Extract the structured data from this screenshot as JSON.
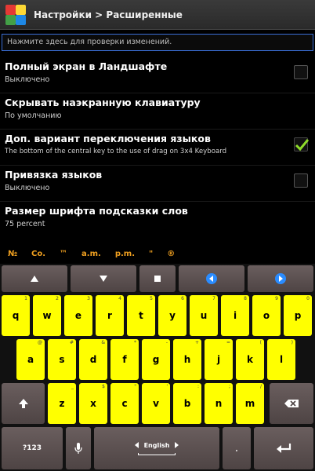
{
  "titlebar": {
    "title": "Настройки > Расширенные",
    "icon": "app-colorful-squares-icon"
  },
  "test_input": {
    "placeholder": "Нажмите здесь для проверки изменений."
  },
  "settings": [
    {
      "title": "Полный экран в Ландшафте",
      "summary": "Выключено",
      "checkbox": true,
      "checked": false
    },
    {
      "title": "Скрывать наэкранную клавиатуру",
      "summary": "По умолчанию",
      "checkbox": false
    },
    {
      "title": "Доп. вариант переключения языков",
      "summary": "The bottom of the central key to the use of drag on 3x4 Keyboard",
      "checkbox": true,
      "checked": true
    },
    {
      "title": "Привязка языков",
      "summary": "Выключено",
      "checkbox": true,
      "checked": false
    },
    {
      "title": "Размер шрифта подсказки слов",
      "summary": "75 percent",
      "checkbox": false
    }
  ],
  "suggestions": [
    "№",
    "Co.",
    "™",
    "a.m.",
    "p.m.",
    "\"",
    "®"
  ],
  "keyboard": {
    "nav_row": [
      "up-arrow-icon",
      "down-arrow-icon",
      "dot-icon",
      "left-circle-arrow-icon",
      "right-circle-arrow-icon"
    ],
    "row1": [
      {
        "l": "q",
        "h": "1"
      },
      {
        "l": "w",
        "h": "2"
      },
      {
        "l": "e",
        "h": "3"
      },
      {
        "l": "r",
        "h": "4"
      },
      {
        "l": "t",
        "h": "5"
      },
      {
        "l": "y",
        "h": "6"
      },
      {
        "l": "u",
        "h": "7"
      },
      {
        "l": "i",
        "h": "8"
      },
      {
        "l": "o",
        "h": "9"
      },
      {
        "l": "p",
        "h": "0"
      }
    ],
    "row2": [
      {
        "l": "a",
        "h": "@"
      },
      {
        "l": "s",
        "h": "#"
      },
      {
        "l": "d",
        "h": "&"
      },
      {
        "l": "f",
        "h": "*"
      },
      {
        "l": "g",
        "h": "-"
      },
      {
        "l": "h",
        "h": "+"
      },
      {
        "l": "j",
        "h": "="
      },
      {
        "l": "k",
        "h": "("
      },
      {
        "l": "l",
        "h": ")"
      }
    ],
    "row3": [
      {
        "l": "z",
        "h": "_"
      },
      {
        "l": "x",
        "h": "$"
      },
      {
        "l": "c",
        "h": "\""
      },
      {
        "l": "v",
        "h": "'"
      },
      {
        "l": "b",
        "h": ":"
      },
      {
        "l": "n",
        "h": ";"
      },
      {
        "l": "m",
        "h": "/"
      }
    ],
    "symbols_label": "?123",
    "space_label": "English",
    "period_label": "."
  }
}
